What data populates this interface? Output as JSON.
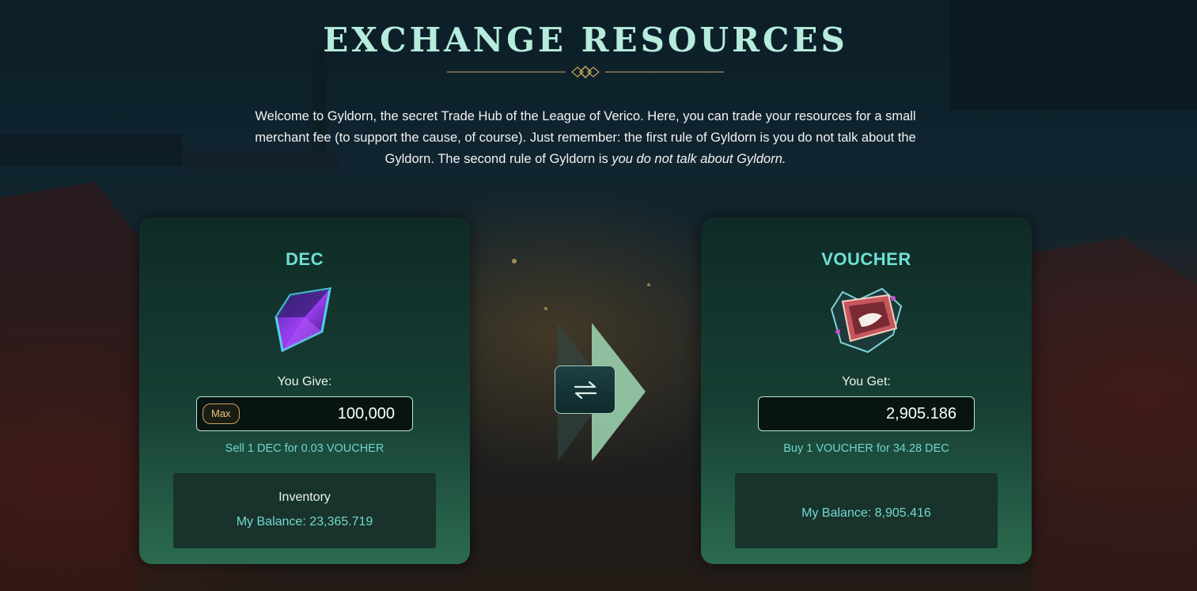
{
  "header": {
    "title": "EXCHANGE RESOURCES",
    "intro_text": "Welcome to Gyldorn, the secret Trade Hub of the League of Verico. Here, you can trade your resources for a small merchant fee (to support the cause, of course). Just remember: the first rule of Gyldorn is you do not talk about the Gyldorn. The second rule of Gyldorn is",
    "intro_emphasis": "you do not talk about Gyldorn."
  },
  "give_panel": {
    "title": "DEC",
    "icon": "crystal-shard-icon",
    "label": "You Give:",
    "max_label": "Max",
    "amount": "100,000",
    "rate": "Sell 1 DEC for 0.03 VOUCHER",
    "inventory_title": "Inventory",
    "balance": "My Balance: 23,365.719"
  },
  "get_panel": {
    "title": "VOUCHER",
    "icon": "voucher-box-icon",
    "label": "You Get:",
    "amount": "2,905.186",
    "rate": "Buy 1 VOUCHER for 34.28 DEC",
    "balance": "My Balance: 8,905.416"
  },
  "swap": {
    "icon": "swap-arrows-icon"
  },
  "colors": {
    "title": "#b7ecdc",
    "accent_teal": "#6fe0d6",
    "max_gold": "#e8c77a",
    "panel_top": "#0f2a26",
    "panel_bottom": "#2b6b4f"
  }
}
